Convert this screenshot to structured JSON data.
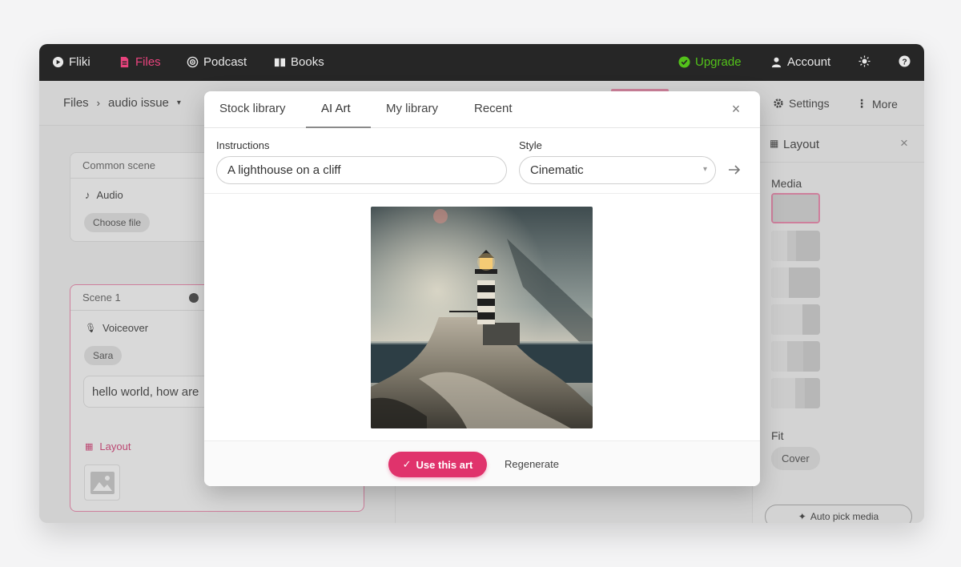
{
  "nav": {
    "logo": "Fliki",
    "files": "Files",
    "podcast": "Podcast",
    "books": "Books",
    "upgrade": "Upgrade",
    "account": "Account"
  },
  "breadcrumb": {
    "root": "Files",
    "current": "audio issue"
  },
  "toolbar": {
    "settings": "Settings",
    "more": "More"
  },
  "common_scene": {
    "title": "Common scene",
    "audio_label": "Audio",
    "choose_file": "Choose file"
  },
  "scene1": {
    "title": "Scene 1",
    "voiceover_label": "Voiceover",
    "voice": "Sara",
    "text": "hello world, how are",
    "layout_label": "Layout"
  },
  "right_panel": {
    "title": "Layout",
    "media_label": "Media",
    "fit_label": "Fit",
    "fit_value": "Cover",
    "auto_pick": "Auto pick media"
  },
  "modal": {
    "tabs": [
      "Stock library",
      "AI Art",
      "My library",
      "Recent"
    ],
    "active_tab": "AI Art",
    "instructions_label": "Instructions",
    "instructions_value": "A lighthouse on a cliff",
    "style_label": "Style",
    "style_value": "Cinematic",
    "use_button": "Use this art",
    "regenerate_button": "Regenerate"
  },
  "colors": {
    "accent": "#e0336c",
    "upgrade": "#53c21a",
    "nav_bg": "#262626"
  },
  "icons": [
    "fliki-logo-icon",
    "file-icon",
    "podcast-icon",
    "book-icon",
    "check-circle-icon",
    "user-icon",
    "sun-icon",
    "help-icon",
    "gear-icon",
    "more-icon",
    "music-note-icon",
    "mic-icon",
    "play-icon",
    "layout-icon",
    "image-icon",
    "close-icon",
    "chevron-down-icon",
    "arrow-right-icon",
    "check-icon",
    "sparkle-icon"
  ]
}
